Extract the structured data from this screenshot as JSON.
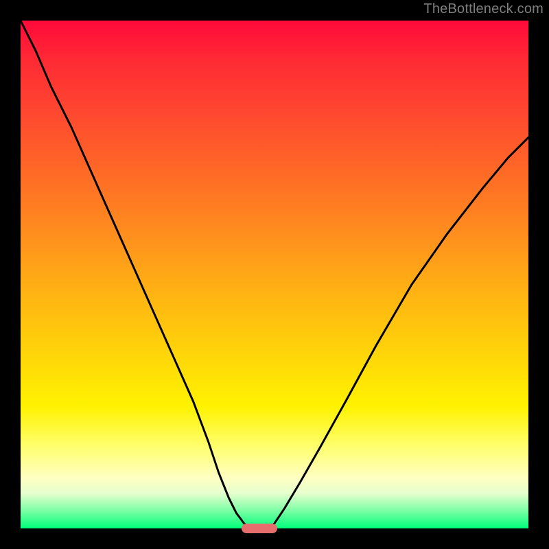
{
  "watermark": "TheBottleneck.com",
  "colors": {
    "black": "#000000",
    "marker": "#e66f6e",
    "watermark_text": "#7e7e7e"
  },
  "chart_data": {
    "type": "line",
    "title": "",
    "xlabel": "",
    "ylabel": "",
    "xlim": [
      0,
      100
    ],
    "ylim": [
      0,
      100
    ],
    "grid": false,
    "series": [
      {
        "name": "left-curve",
        "x": [
          0,
          3,
          6,
          10,
          14,
          18,
          22,
          26,
          30,
          34,
          37,
          39,
          41,
          42.5,
          44,
          45
        ],
        "values": [
          100,
          94,
          87,
          79,
          70,
          61,
          52,
          43,
          34,
          25,
          17,
          11,
          6,
          3,
          1,
          0
        ]
      },
      {
        "name": "right-curve",
        "x": [
          49,
          50,
          52,
          55,
          59,
          64,
          70,
          77,
          84,
          91,
          96,
          100
        ],
        "values": [
          0,
          1,
          4,
          9,
          16,
          25,
          36,
          48,
          58,
          67,
          73,
          77
        ]
      }
    ],
    "marker": {
      "x_center": 47,
      "x_width": 7,
      "y": 0,
      "color": "#e66f6e"
    },
    "background_gradient": {
      "stops": [
        {
          "pos": 0.0,
          "color": "#ff0a3a"
        },
        {
          "pos": 0.3,
          "color": "#ff6a26"
        },
        {
          "pos": 0.66,
          "color": "#ffd609"
        },
        {
          "pos": 0.84,
          "color": "#ffff70"
        },
        {
          "pos": 0.93,
          "color": "#e7ffcf"
        },
        {
          "pos": 1.0,
          "color": "#00ff7a"
        }
      ]
    }
  }
}
